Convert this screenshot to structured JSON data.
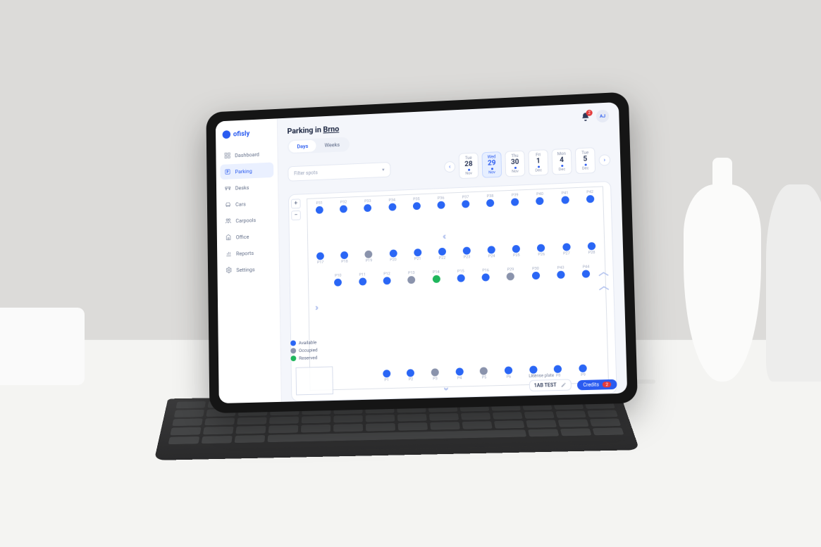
{
  "brand": "ofisly",
  "notification_count": "2",
  "avatar_initials": "AJ",
  "page_title_prefix": "Parking in ",
  "page_title_location": "Brno",
  "sidebar": {
    "items": [
      {
        "label": "Dashboard",
        "icon": "dashboard"
      },
      {
        "label": "Parking",
        "icon": "parking",
        "active": true
      },
      {
        "label": "Desks",
        "icon": "desks"
      },
      {
        "label": "Cars",
        "icon": "cars"
      },
      {
        "label": "Carpools",
        "icon": "carpools"
      },
      {
        "label": "Office",
        "icon": "office"
      },
      {
        "label": "Reports",
        "icon": "reports"
      },
      {
        "label": "Settings",
        "icon": "settings"
      }
    ]
  },
  "tabs": {
    "days": "Days",
    "weeks": "Weeks",
    "active": "days"
  },
  "filter_placeholder": "Filter spots",
  "dates": [
    {
      "dow": "Tue",
      "num": "28",
      "mon": "Nov"
    },
    {
      "dow": "Wed",
      "num": "29",
      "mon": "Nov",
      "active": true
    },
    {
      "dow": "Thu",
      "num": "30",
      "mon": "Nov"
    },
    {
      "dow": "Fri",
      "num": "1",
      "mon": "Dec"
    },
    {
      "dow": "Mon",
      "num": "4",
      "mon": "Dec"
    },
    {
      "dow": "Tue",
      "num": "5",
      "mon": "Dec"
    }
  ],
  "legend": {
    "available": "Available",
    "occupied": "Occupied",
    "reserved": "Reserved"
  },
  "zoom_plus": "+",
  "zoom_minus": "−",
  "spots": {
    "row1": [
      {
        "l": "P31",
        "s": "avail"
      },
      {
        "l": "P32",
        "s": "avail"
      },
      {
        "l": "P33",
        "s": "avail"
      },
      {
        "l": "P34",
        "s": "avail"
      },
      {
        "l": "P35",
        "s": "avail"
      },
      {
        "l": "P36",
        "s": "avail"
      },
      {
        "l": "P37",
        "s": "avail"
      },
      {
        "l": "P38",
        "s": "avail"
      },
      {
        "l": "P39",
        "s": "avail"
      },
      {
        "l": "P40",
        "s": "avail"
      },
      {
        "l": "P41",
        "s": "avail"
      },
      {
        "l": "P42",
        "s": "avail"
      }
    ],
    "row2": [
      {
        "l": "P17",
        "s": "avail"
      },
      {
        "l": "P18",
        "s": "avail"
      },
      {
        "l": "P19",
        "s": "occ"
      },
      {
        "l": "P20",
        "s": "avail"
      },
      {
        "l": "P21",
        "s": "avail"
      },
      {
        "l": "P22",
        "s": "avail"
      },
      {
        "l": "P23",
        "s": "avail"
      },
      {
        "l": "P24",
        "s": "avail"
      },
      {
        "l": "P25",
        "s": "avail"
      },
      {
        "l": "P26",
        "s": "avail"
      },
      {
        "l": "P27",
        "s": "avail"
      },
      {
        "l": "P28",
        "s": "avail"
      }
    ],
    "row3": [
      {
        "l": "P10",
        "s": "avail"
      },
      {
        "l": "P11",
        "s": "avail"
      },
      {
        "l": "P12",
        "s": "avail"
      },
      {
        "l": "P13",
        "s": "occ"
      },
      {
        "l": "P14",
        "s": "res"
      },
      {
        "l": "P15",
        "s": "avail"
      },
      {
        "l": "P16",
        "s": "avail"
      },
      {
        "l": "P29",
        "s": "occ"
      },
      {
        "l": "P30",
        "s": "avail"
      },
      {
        "l": "P43",
        "s": "avail"
      },
      {
        "l": "P44",
        "s": "avail"
      }
    ],
    "row4": [
      {
        "l": "P1",
        "s": "avail"
      },
      {
        "l": "P2",
        "s": "avail"
      },
      {
        "l": "P3",
        "s": "occ"
      },
      {
        "l": "P4",
        "s": "avail"
      },
      {
        "l": "P5",
        "s": "occ"
      },
      {
        "l": "P6",
        "s": "avail"
      },
      {
        "l": "P7",
        "s": "avail"
      },
      {
        "l": "P8",
        "s": "avail"
      },
      {
        "l": "P9",
        "s": "avail"
      }
    ]
  },
  "license": {
    "label": "License plate",
    "value": "1AB TEST"
  },
  "credits": {
    "label": "Credits",
    "count": "2"
  }
}
